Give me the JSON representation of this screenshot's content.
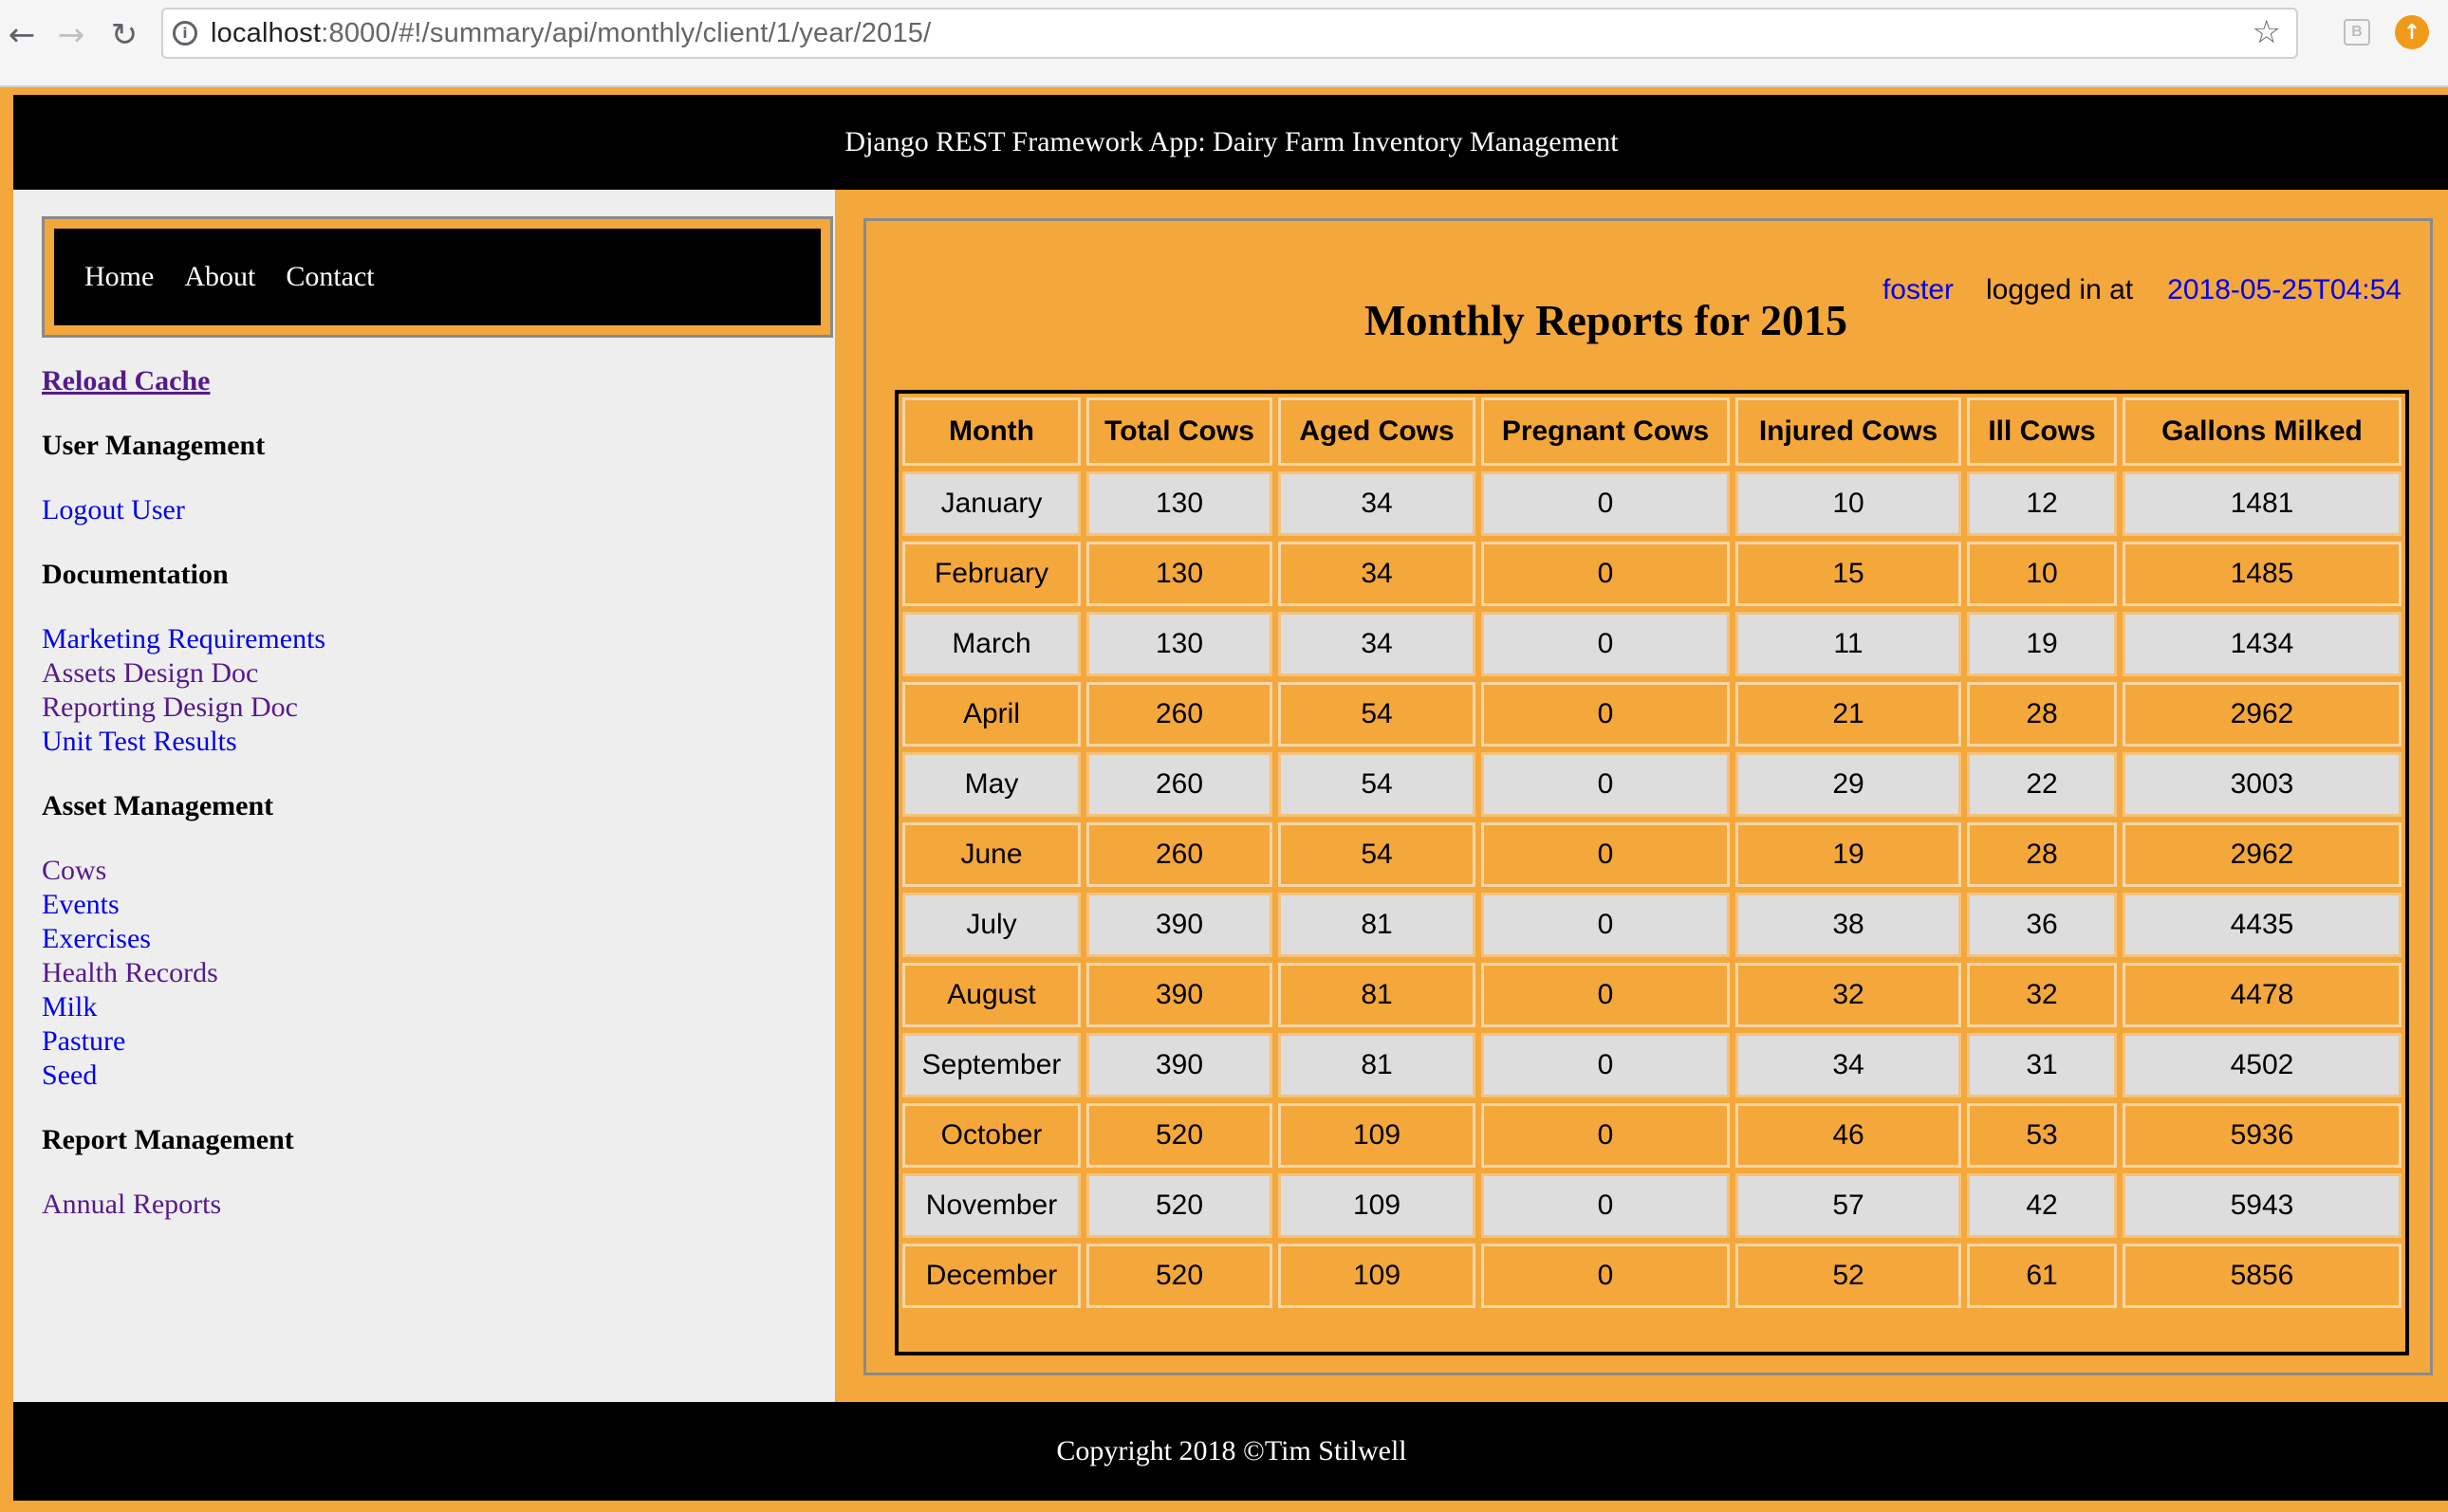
{
  "browser": {
    "url_host": "localhost",
    "url_path": ":8000/#!/summary/api/monthly/client/1/year/2015/"
  },
  "site": {
    "header_title": "Django REST Framework App: Dairy Farm Inventory Management",
    "footer_text": "Copyright 2018 ©Tim Stilwell"
  },
  "topnav": {
    "items": [
      {
        "label": "Home"
      },
      {
        "label": "About"
      },
      {
        "label": "Contact"
      }
    ]
  },
  "sidebar": {
    "reload_cache": "Reload Cache",
    "user_management": {
      "heading": "User Management",
      "links": [
        {
          "label": "Logout User"
        }
      ]
    },
    "documentation": {
      "heading": "Documentation",
      "links": [
        {
          "label": "Marketing Requirements"
        },
        {
          "label": "Assets Design Doc"
        },
        {
          "label": "Reporting Design Doc"
        },
        {
          "label": "Unit Test Results"
        }
      ]
    },
    "asset_management": {
      "heading": "Asset Management",
      "links": [
        {
          "label": "Cows"
        },
        {
          "label": "Events"
        },
        {
          "label": "Exercises"
        },
        {
          "label": "Health Records"
        },
        {
          "label": "Milk"
        },
        {
          "label": "Pasture"
        },
        {
          "label": "Seed"
        }
      ]
    },
    "report_management": {
      "heading": "Report Management",
      "links": [
        {
          "label": "Annual Reports"
        }
      ]
    }
  },
  "main": {
    "user": "foster",
    "logged_in_label": "logged in at",
    "login_time": "2018-05-25T04:54",
    "title": "Monthly Reports for 2015",
    "table": {
      "columns": [
        "Month",
        "Total Cows",
        "Aged Cows",
        "Pregnant Cows",
        "Injured Cows",
        "Ill Cows",
        "Gallons Milked"
      ],
      "rows": [
        [
          "January",
          "130",
          "34",
          "0",
          "10",
          "12",
          "1481"
        ],
        [
          "February",
          "130",
          "34",
          "0",
          "15",
          "10",
          "1485"
        ],
        [
          "March",
          "130",
          "34",
          "0",
          "11",
          "19",
          "1434"
        ],
        [
          "April",
          "260",
          "54",
          "0",
          "21",
          "28",
          "2962"
        ],
        [
          "May",
          "260",
          "54",
          "0",
          "29",
          "22",
          "3003"
        ],
        [
          "June",
          "260",
          "54",
          "0",
          "19",
          "28",
          "2962"
        ],
        [
          "July",
          "390",
          "81",
          "0",
          "38",
          "36",
          "4435"
        ],
        [
          "August",
          "390",
          "81",
          "0",
          "32",
          "32",
          "4478"
        ],
        [
          "September",
          "390",
          "81",
          "0",
          "34",
          "31",
          "4502"
        ],
        [
          "October",
          "520",
          "109",
          "0",
          "46",
          "53",
          "5936"
        ],
        [
          "November",
          "520",
          "109",
          "0",
          "57",
          "42",
          "5943"
        ],
        [
          "December",
          "520",
          "109",
          "0",
          "52",
          "61",
          "5856"
        ]
      ]
    }
  },
  "colors": {
    "orange": "#f4a73b",
    "black": "#000000",
    "sidebar_bg": "#eeeeee",
    "link_blue": "#0000ee",
    "link_visited": "#551a8b",
    "row_gray": "#dddddd"
  }
}
